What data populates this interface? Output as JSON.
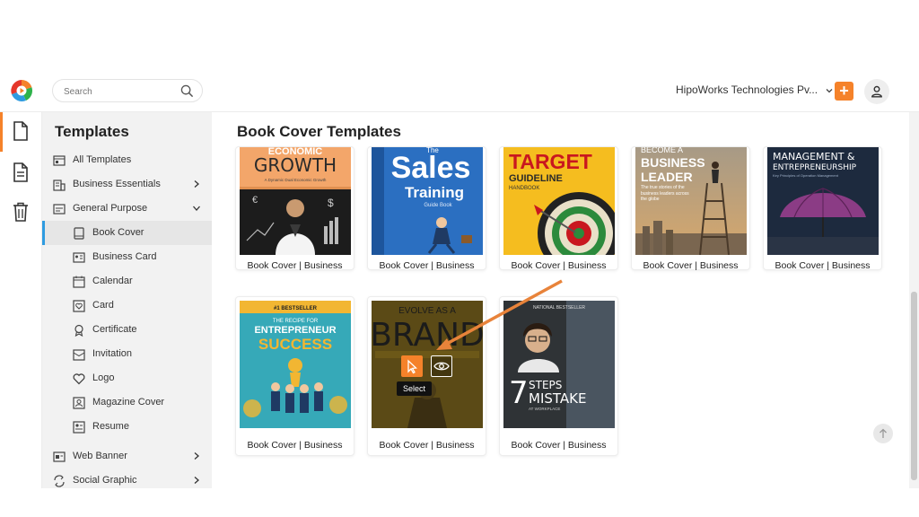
{
  "header": {
    "search_placeholder": "Search",
    "company": "HipoWorks Technologies Pv...",
    "plus_label": "+"
  },
  "sidebar": {
    "title": "Templates",
    "items": [
      {
        "label": "All Templates"
      },
      {
        "label": "Business Essentials"
      },
      {
        "label": "General Purpose"
      },
      {
        "label": "Book Cover"
      },
      {
        "label": "Business Card"
      },
      {
        "label": "Calendar"
      },
      {
        "label": "Card"
      },
      {
        "label": "Certificate"
      },
      {
        "label": "Invitation"
      },
      {
        "label": "Logo"
      },
      {
        "label": "Magazine Cover"
      },
      {
        "label": "Resume"
      },
      {
        "label": "Web Banner"
      },
      {
        "label": "Social Graphic"
      }
    ]
  },
  "main": {
    "title": "Book Cover Templates",
    "tooltip": "Select",
    "cards": [
      {
        "caption": "Book Cover | Business",
        "art": {
          "top": "ECONOMIC",
          "big": "GROWTH",
          "sub": "A Dynamic Dual Economic Growth"
        }
      },
      {
        "caption": "Book Cover | Business",
        "art": {
          "top": "The",
          "big": "Sales",
          "big2": "Training",
          "sub": "Guide Book"
        }
      },
      {
        "caption": "Book Cover | Business",
        "art": {
          "big": "TARGET",
          "big2": "GUIDELINE",
          "sub": "HANDBOOK"
        }
      },
      {
        "caption": "Book Cover | Business",
        "art": {
          "top": "BECOME A",
          "big": "BUSINESS",
          "big2": "LEADER",
          "sub": "The true stories of the business leaders across the globe"
        }
      },
      {
        "caption": "Book Cover | Business",
        "art": {
          "big": "MANAGEMENT &",
          "big2": "ENTREPRENEURSHIP",
          "sub": "Key Principles of Operation Management"
        }
      },
      {
        "caption": "Book Cover | Business",
        "art": {
          "top": "#1 BESTSELLER",
          "top2": "THE RECIPE FOR",
          "big": "ENTREPRENEUR",
          "big2": "SUCCESS"
        }
      },
      {
        "caption": "Book Cover | Business",
        "art": {
          "top": "EVOLVE AS A",
          "big": "BRAND"
        }
      },
      {
        "caption": "Book Cover | Business",
        "art": {
          "top": "NATIONAL BESTSELLER",
          "num": "7",
          "big": "STEPS",
          "big2": "MISTAKE",
          "sub": "AT WORKPLACE"
        }
      }
    ]
  },
  "colors": {
    "accent": "#f5822a",
    "selected_bar": "#2f9be0",
    "sidebar_bg": "#f2f2f2"
  },
  "icons": [
    "logo-icon",
    "search-icon",
    "chevron-down-icon",
    "plus-icon",
    "user-icon",
    "document-icon",
    "file-text-icon",
    "trash-icon",
    "arrow-up-icon",
    "cursor-icon",
    "eye-icon"
  ]
}
